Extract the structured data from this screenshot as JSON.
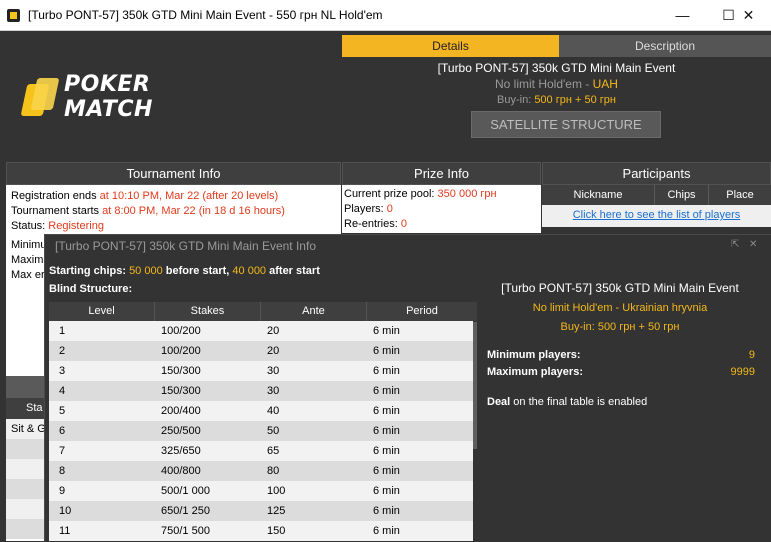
{
  "window": {
    "title": "[Turbo PONT-57] 350k GTD Mini Main Event - 550 грн NL Hold'em",
    "minimize_glyph": "—",
    "maximize_glyph": "☐",
    "close_glyph": "✕"
  },
  "logo": {
    "line1": "POKER",
    "line2": "MATCH",
    "accent": "#f6c31b"
  },
  "tabs": [
    {
      "label": "Details",
      "active": true
    },
    {
      "label": "Description",
      "active": false
    }
  ],
  "header": {
    "name": "[Turbo PONT-57] 350k GTD Mini Main Event",
    "game_prefix": "No limit Hold'em - ",
    "currency": "UAH",
    "buyin_label": "Buy-in: ",
    "buyin_value": "500 грн + 50 грн",
    "satellite_button": "SATELLITE STRUCTURE"
  },
  "tournament_info": {
    "title": "Tournament Info",
    "reg_label": "Registration ends ",
    "reg_value": "at 10:10 PM, Mar 22 (after 20 levels)",
    "start_label": "Tournament starts ",
    "start_value": "at 8:00 PM, Mar 22 (in 18 d 16 hours)",
    "status_label": "Status: ",
    "status_value": "Registering",
    "hidden_rows": [
      "Minimu",
      "Maxim",
      "Max er"
    ]
  },
  "prize_info": {
    "title": "Prize Info",
    "pool_label": "Current prize pool: ",
    "pool_value": "350 000 грн",
    "players_label": "Players: ",
    "players_value": "0",
    "reentries_label": "Re-entries: ",
    "reentries_value": "0"
  },
  "participants": {
    "title": "Participants",
    "columns": [
      "Nickname",
      "Chips",
      "Place"
    ],
    "link": "Click here to see the list of players"
  },
  "peek": {
    "header": "Sta",
    "row1": "Sit & G"
  },
  "overlay": {
    "title": "[Turbo PONT-57] 350k GTD Mini Main Event Info",
    "popout_icon": "popout-icon",
    "close_icon": "close-icon",
    "starting_chips_label": "Starting chips: ",
    "chips_before": "50 000",
    "before_text": " before start, ",
    "chips_after": "40 000",
    "after_text": " after start",
    "blind_structure_label": "Blind Structure:",
    "blind_columns": [
      "Level",
      "Stakes",
      "Ante",
      "Period"
    ],
    "blinds": [
      [
        "1",
        "100/200",
        "20",
        "6 min"
      ],
      [
        "2",
        "100/200",
        "20",
        "6 min"
      ],
      [
        "3",
        "150/300",
        "30",
        "6 min"
      ],
      [
        "4",
        "150/300",
        "30",
        "6 min"
      ],
      [
        "5",
        "200/400",
        "40",
        "6 min"
      ],
      [
        "6",
        "250/500",
        "50",
        "6 min"
      ],
      [
        "7",
        "325/650",
        "65",
        "6 min"
      ],
      [
        "8",
        "400/800",
        "80",
        "6 min"
      ],
      [
        "9",
        "500/1 000",
        "100",
        "6 min"
      ],
      [
        "10",
        "650/1 250",
        "125",
        "6 min"
      ],
      [
        "11",
        "750/1 500",
        "150",
        "6 min"
      ]
    ],
    "right": {
      "name": "[Turbo PONT-57] 350k GTD Mini Main Event",
      "game": "No limit Hold'em - Ukrainian hryvnia",
      "buyin": "Buy-in:  500 грн + 50 грн",
      "min_label": "Minimum players:",
      "min_value": "9",
      "max_label": "Maximum players:",
      "max_value": "9999",
      "deal_bold": "Deal",
      "deal_rest": " on the final table is enabled"
    }
  },
  "colors": {
    "gold": "#f3b81a",
    "red": "#e03a1c",
    "bg": "#333333",
    "link": "#1a6fd0"
  }
}
